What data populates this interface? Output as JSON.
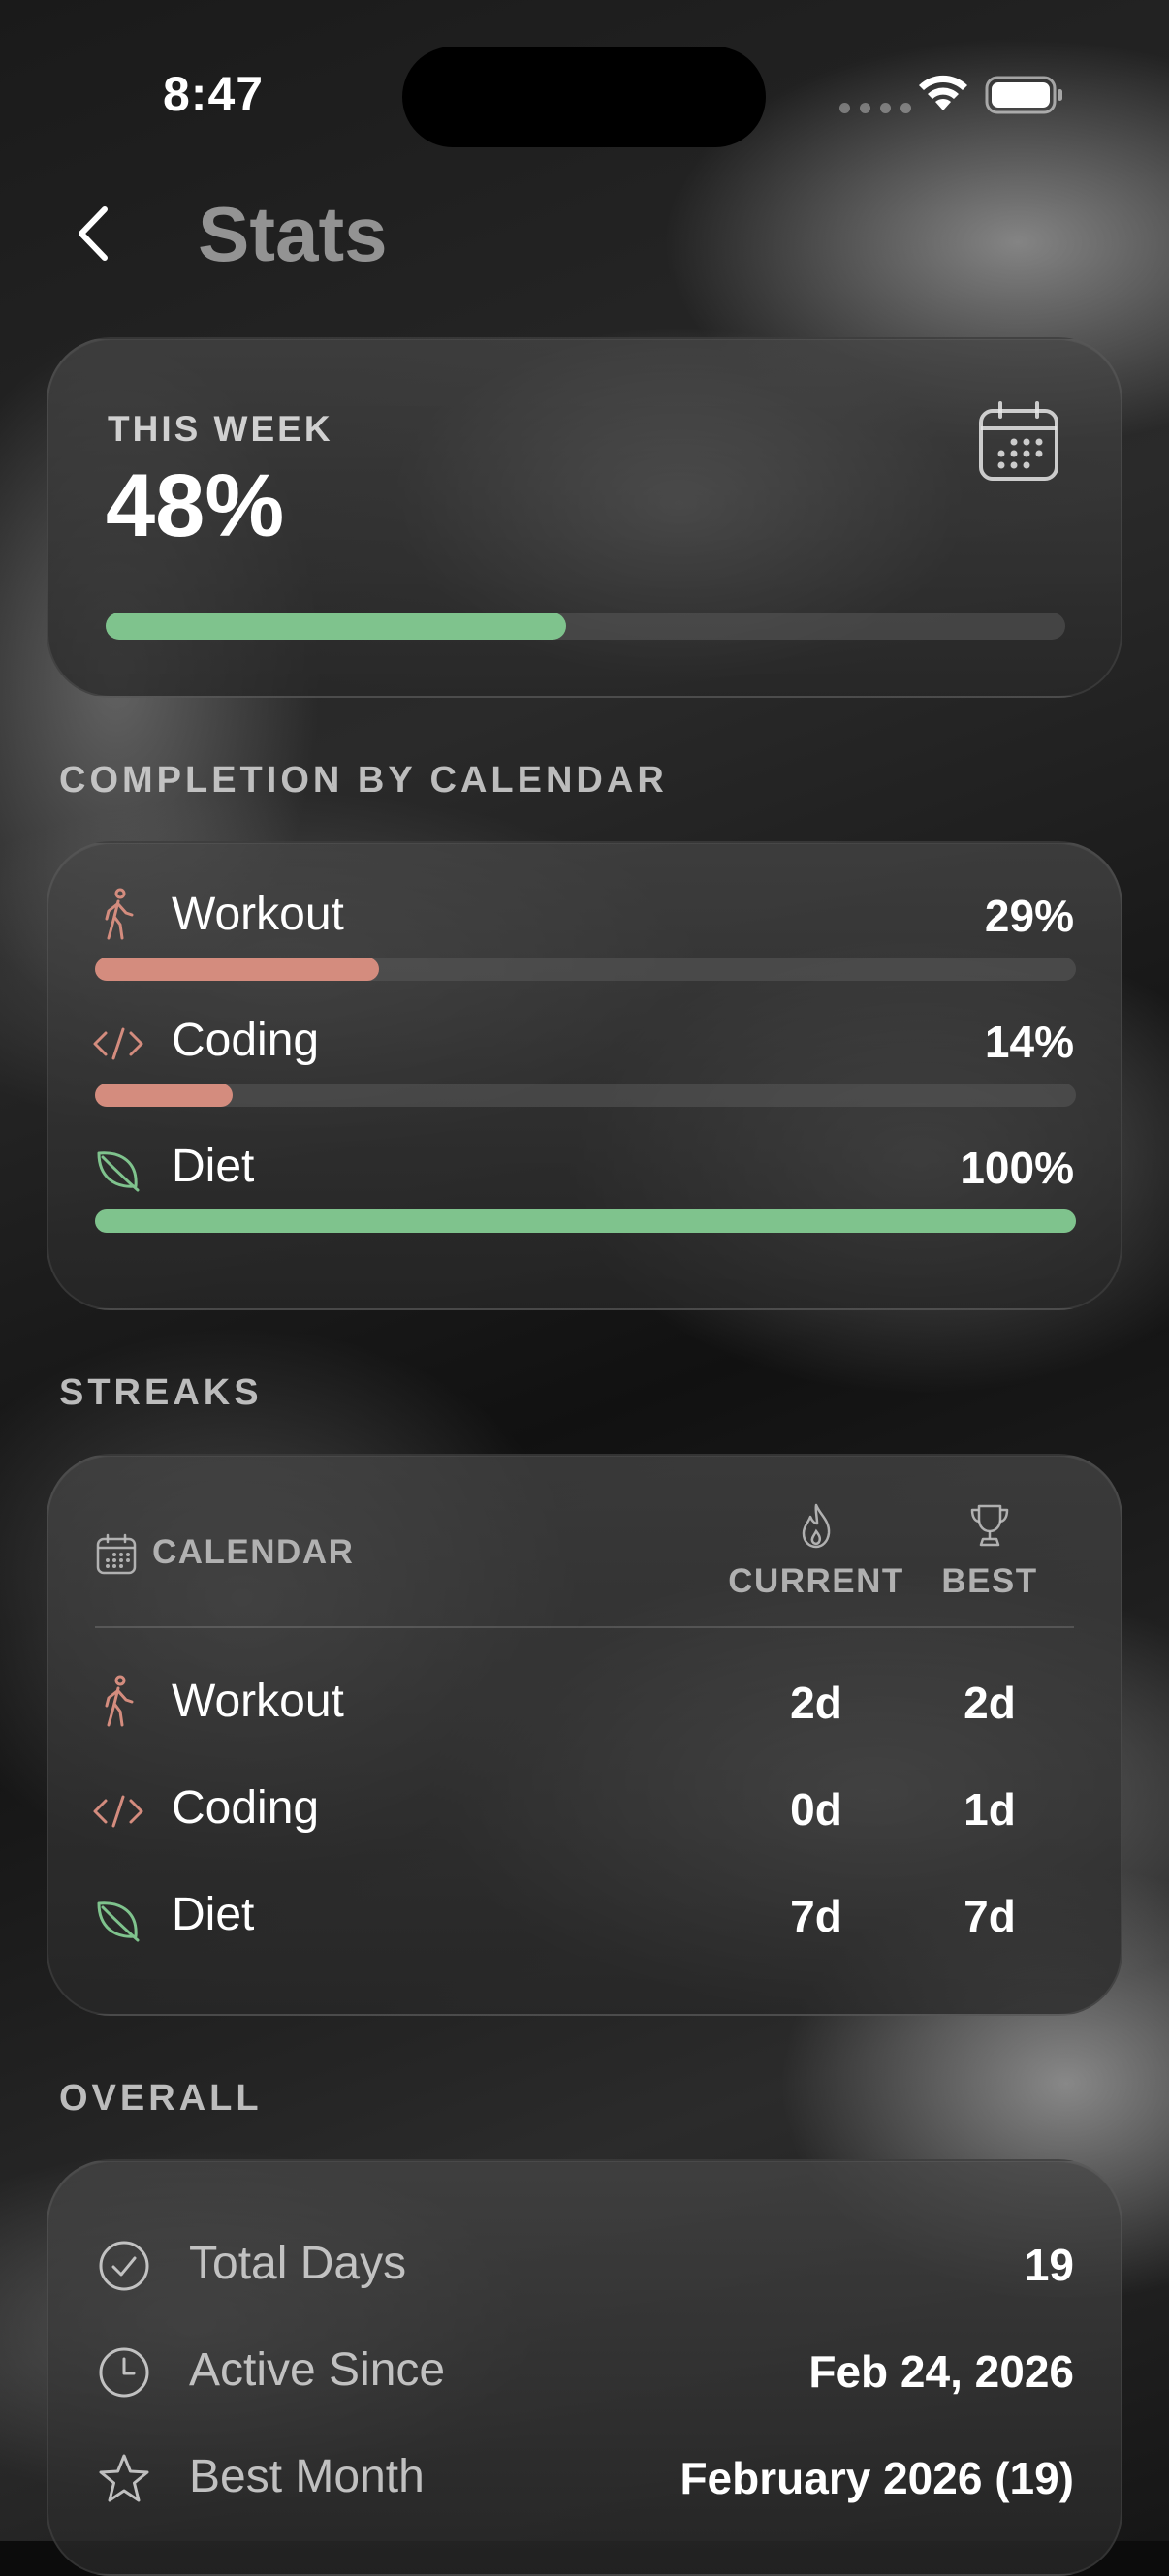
{
  "status_bar": {
    "time": "8:47"
  },
  "header": {
    "title": "Stats"
  },
  "this_week": {
    "label": "THIS WEEK",
    "value": "48%",
    "progress": 0.48
  },
  "completion": {
    "section_title": "COMPLETION BY CALENDAR",
    "items": [
      {
        "label": "Workout",
        "value": "29%",
        "progress": 0.29,
        "color": "#d48c7e",
        "icon": "walking-person-icon"
      },
      {
        "label": "Coding",
        "value": "14%",
        "progress": 0.14,
        "color": "#d48c7e",
        "icon": "code-icon"
      },
      {
        "label": "Diet",
        "value": "100%",
        "progress": 1.0,
        "color": "#7fc38d",
        "icon": "leaf-icon"
      }
    ]
  },
  "streaks": {
    "section_title": "STREAKS",
    "headers": {
      "calendar": "CALENDAR",
      "current": "CURRENT",
      "best": "BEST"
    },
    "rows": [
      {
        "label": "Workout",
        "current": "2d",
        "best": "2d",
        "icon": "walking-person-icon"
      },
      {
        "label": "Coding",
        "current": "0d",
        "best": "1d",
        "icon": "code-icon"
      },
      {
        "label": "Diet",
        "current": "7d",
        "best": "7d",
        "icon": "leaf-icon"
      }
    ]
  },
  "overall": {
    "section_title": "OVERALL",
    "rows": [
      {
        "label": "Total Days",
        "value": "19",
        "icon": "checkmark-circle-icon"
      },
      {
        "label": "Active Since",
        "value": "Feb 24, 2026",
        "icon": "clock-icon"
      },
      {
        "label": "Best Month",
        "value": "February 2026 (19)",
        "icon": "star-icon"
      }
    ]
  },
  "colors": {
    "accent_green": "#7fc38d",
    "accent_salmon": "#d48c7e",
    "track": "#4a4a4a"
  }
}
